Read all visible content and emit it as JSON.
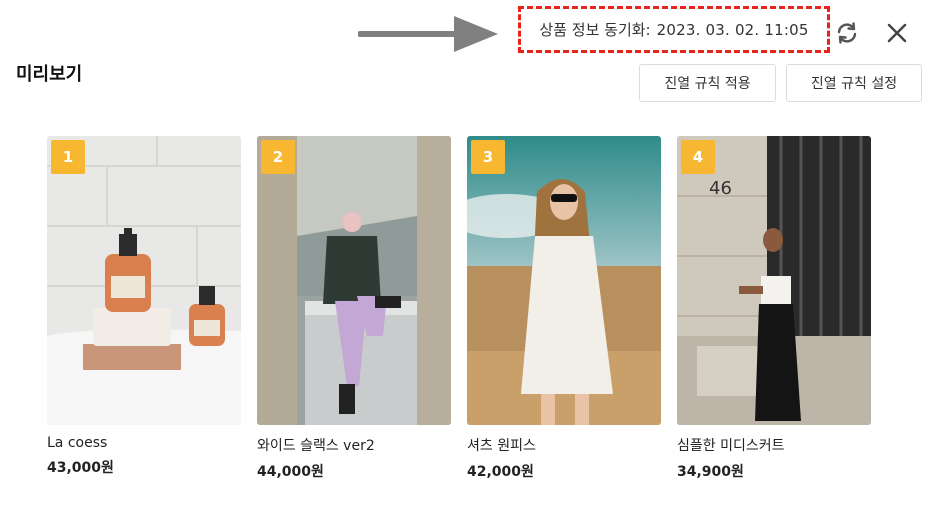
{
  "header": {
    "sync_label": "상품 정보 동기화:",
    "sync_time": "2023. 03. 02. 11:05",
    "refresh_icon": "refresh-icon",
    "close_icon": "close-icon"
  },
  "title": "미리보기",
  "buttons": {
    "apply_rule": "진열 규칙 적용",
    "set_rule": "진열 규칙 설정"
  },
  "products": [
    {
      "rank": "1",
      "name": "La coess",
      "price": "43,000원"
    },
    {
      "rank": "2",
      "name": "와이드 슬랙스 ver2",
      "price": "44,000원"
    },
    {
      "rank": "3",
      "name": "셔츠 원피스",
      "price": "42,000원"
    },
    {
      "rank": "4",
      "name": "심플한 미디스커트",
      "price": "34,900원"
    }
  ],
  "colors": {
    "badge": "#f7b731",
    "highlight_border": "#e8231b"
  }
}
